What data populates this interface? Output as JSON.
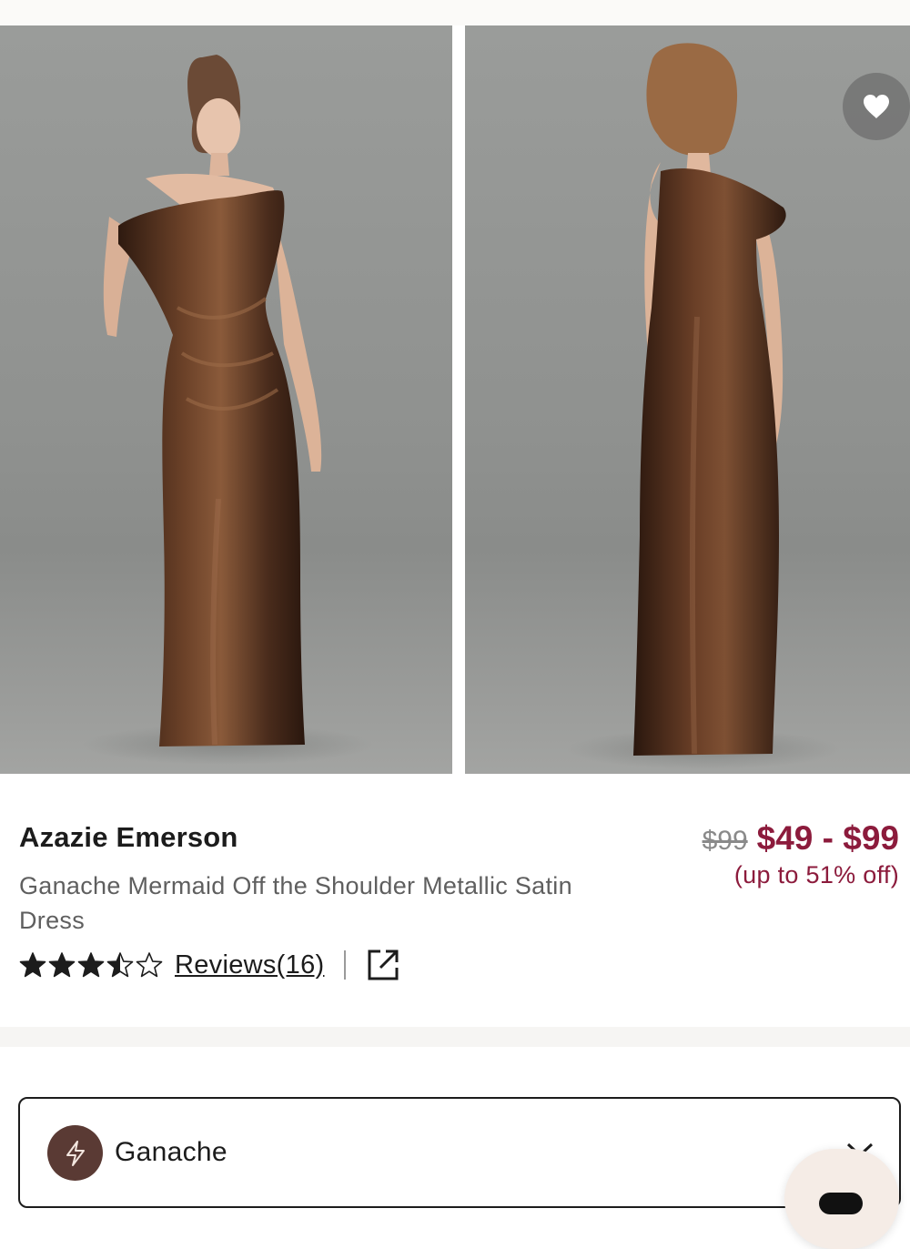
{
  "product": {
    "brand": "Azazie Emerson",
    "name": "Ganache Mermaid Off the Shoulder Metallic Satin Dress",
    "original_price": "$99",
    "sale_price": "$49 - $99",
    "discount": "(up to 51% off)",
    "rating": 3.5,
    "rating_max": 5,
    "reviews_label": "Reviews(16)"
  },
  "gallery": {
    "images": [
      {
        "view": "front",
        "alt": "Model wearing brown satin one-shoulder dress, front view"
      },
      {
        "view": "back",
        "alt": "Model wearing brown satin one-shoulder dress, back view"
      }
    ],
    "favorite_icon": "heart-icon"
  },
  "color_selector": {
    "selected": "Ganache",
    "swatch_color": "#5a3a34",
    "swatch_icon": "lightning-icon",
    "chevron_icon": "chevron-down-icon"
  },
  "colors": {
    "accent": "#8c1b3c",
    "text": "#1c1c1c",
    "muted": "#5f5f5f"
  }
}
